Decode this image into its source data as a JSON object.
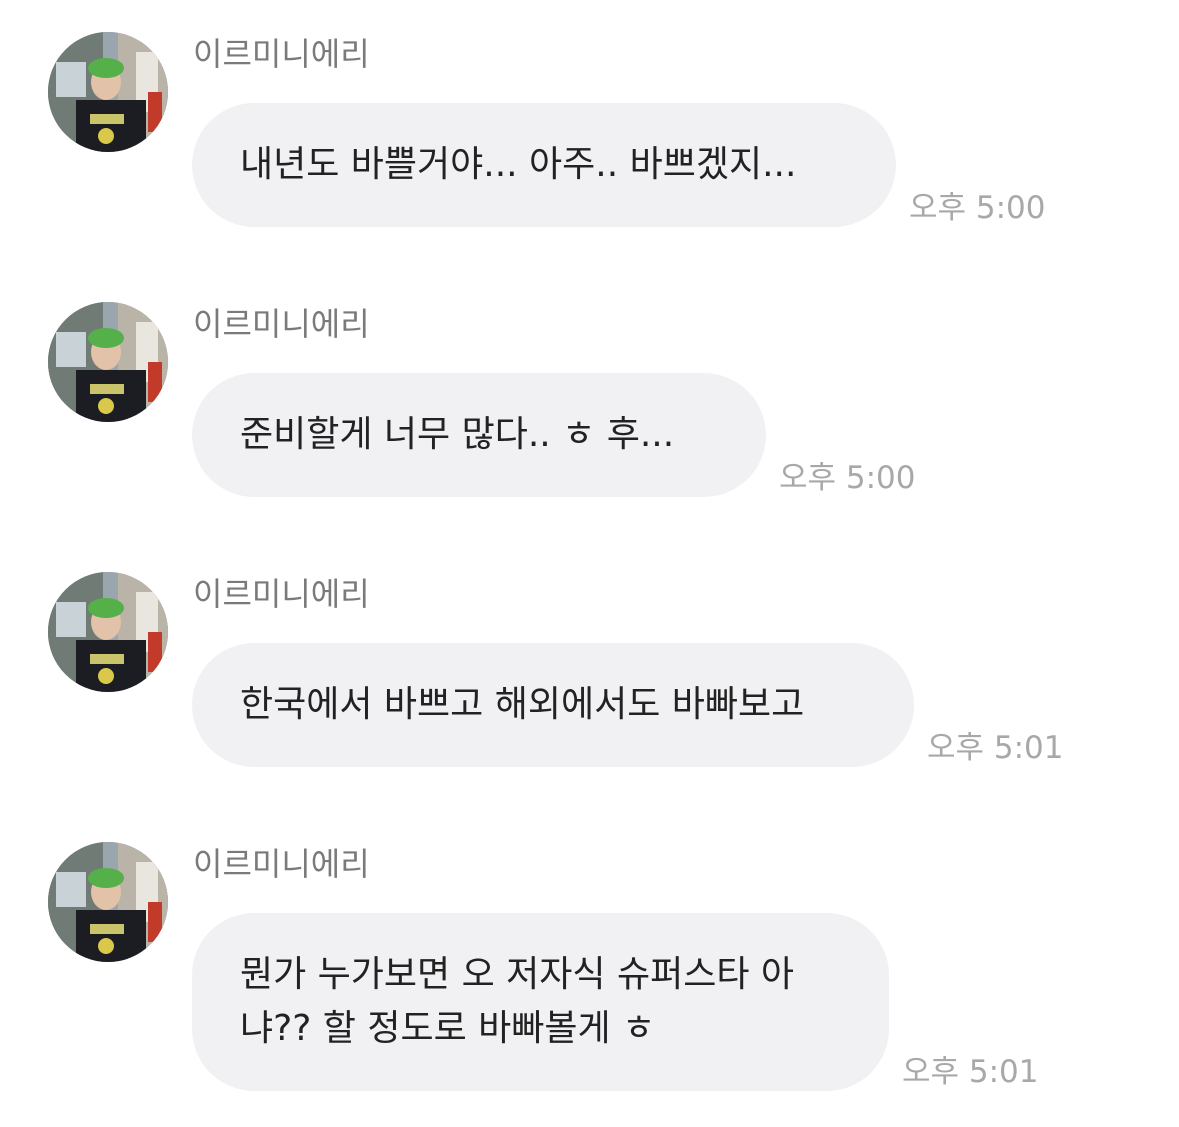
{
  "messages": [
    {
      "sender": "이르미니에리",
      "text": "내년도 바쁠거야... 아주.. 바쁘겠지...",
      "time": "오후 5:00"
    },
    {
      "sender": "이르미니에리",
      "text": "준비할게 너무 많다.. ㅎ 후...",
      "time": "오후 5:00"
    },
    {
      "sender": "이르미니에리",
      "text": "한국에서 바쁘고 해외에서도 바빠보고",
      "time": "오후 5:01"
    },
    {
      "sender": "이르미니에리",
      "text": "뭔가 누가보면 오 저자식 슈퍼스타 아\n냐?? 할 정도로 바빠볼게 ㅎ",
      "time": "오후 5:01"
    }
  ],
  "icons": {
    "avatar": "profile-photo"
  }
}
